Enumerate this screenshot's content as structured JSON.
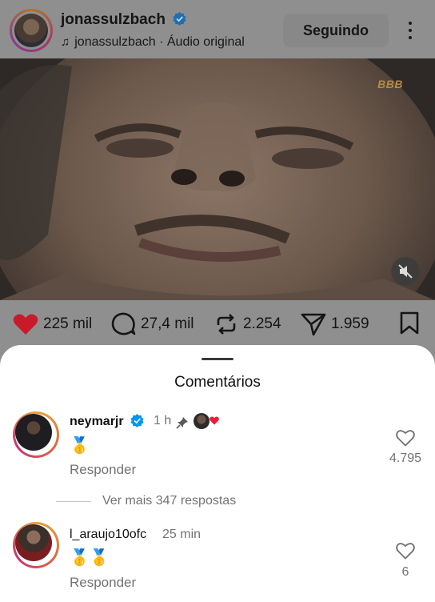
{
  "post": {
    "username": "jonassulzbach",
    "audio_label": "jonassulzbach · Áudio original",
    "follow_label": "Seguindo",
    "video_watermark": "BBB"
  },
  "actions": {
    "likes": "225 mil",
    "comments": "27,4 mil",
    "reposts": "2.254",
    "shares": "1.959"
  },
  "sheet": {
    "title": "Comentários",
    "comments": [
      {
        "username": "neymarjr",
        "time": "1 h",
        "text": "🥇",
        "reply_label": "Responder",
        "like_count": "4.795"
      },
      {
        "username": "l_araujo10ofc",
        "time": "25 min",
        "text": "🥇🥇",
        "reply_label": "Responder",
        "like_count": "6"
      }
    ],
    "more_replies": "Ver mais 347 respostas"
  },
  "colors": {
    "like_red": "#d8122a",
    "verified_blue": "#0095f6",
    "muted_text": "#737373"
  },
  "icons": [
    "music-note-icon",
    "verified-icon",
    "more-icon",
    "mute-icon",
    "heart-icon",
    "comment-icon",
    "repost-icon",
    "share-icon",
    "bookmark-icon",
    "pin-icon"
  ]
}
